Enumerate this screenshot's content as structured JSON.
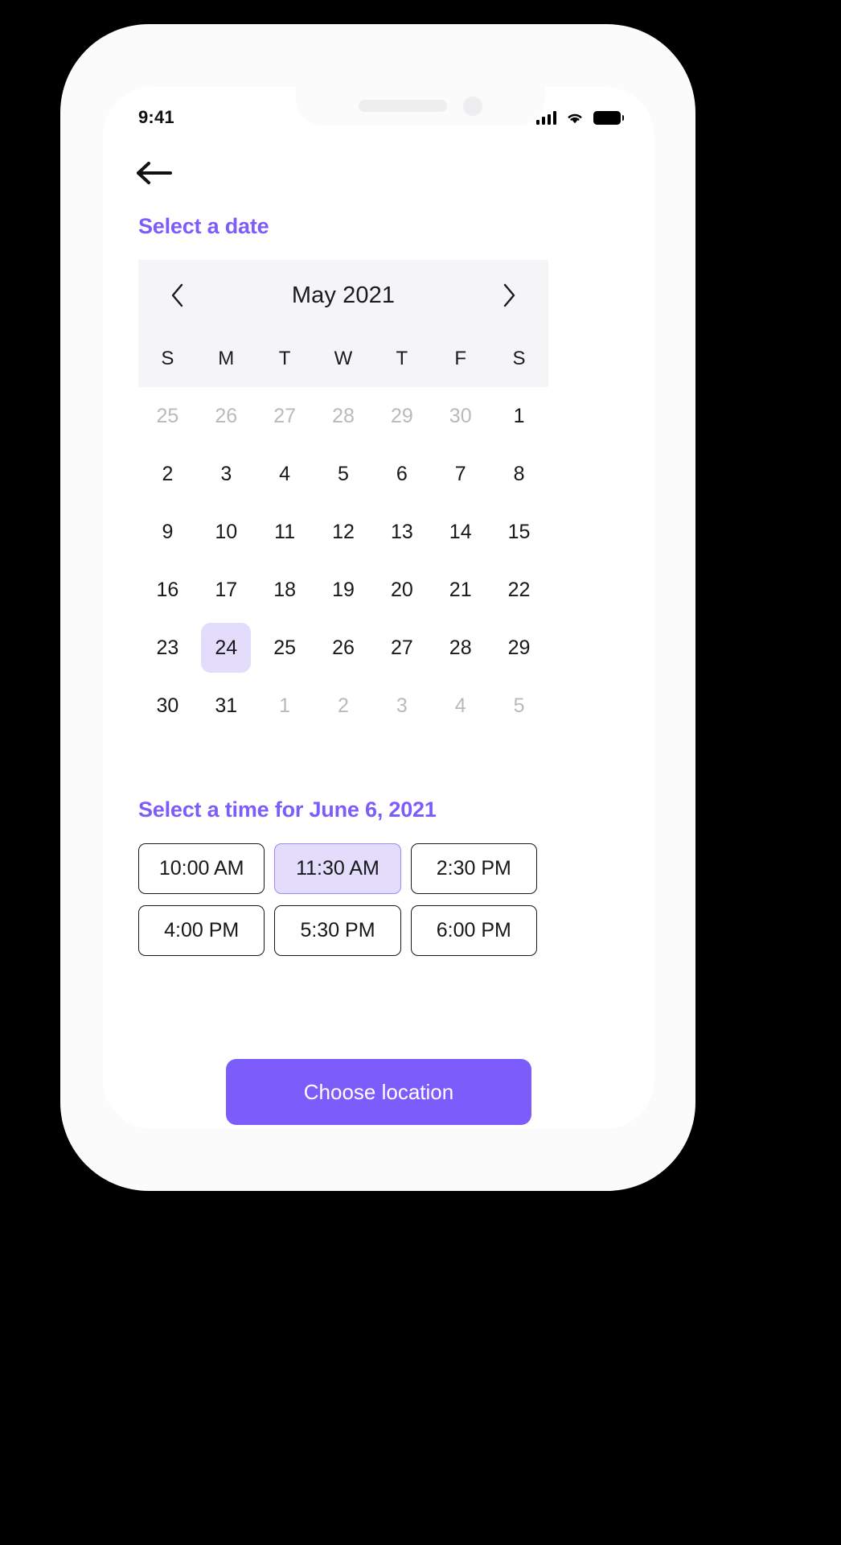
{
  "colors": {
    "accent": "#7c5cfa",
    "selected_bg": "#e3ddfb",
    "selected_border": "#9d87f7",
    "header_bg": "#f5f5f7",
    "text": "#17171c",
    "muted_text": "#b9b9be",
    "page_bg": "#000000",
    "screen_bg": "#ffffff"
  },
  "status_bar": {
    "time": "9:41",
    "icons": [
      "signal-icon",
      "wifi-icon",
      "battery-icon"
    ]
  },
  "nav": {
    "back_icon": "arrow-left-icon"
  },
  "date_section": {
    "title": "Select a date"
  },
  "calendar": {
    "prev_icon": "chevron-left-icon",
    "next_icon": "chevron-right-icon",
    "month_label": "May 2021",
    "weekdays": [
      "S",
      "M",
      "T",
      "W",
      "T",
      "F",
      "S"
    ],
    "weeks": [
      [
        {
          "day": "25",
          "muted": true,
          "selected": false
        },
        {
          "day": "26",
          "muted": true,
          "selected": false
        },
        {
          "day": "27",
          "muted": true,
          "selected": false
        },
        {
          "day": "28",
          "muted": true,
          "selected": false
        },
        {
          "day": "29",
          "muted": true,
          "selected": false
        },
        {
          "day": "30",
          "muted": true,
          "selected": false
        },
        {
          "day": "1",
          "muted": false,
          "selected": false
        }
      ],
      [
        {
          "day": "2",
          "muted": false,
          "selected": false
        },
        {
          "day": "3",
          "muted": false,
          "selected": false
        },
        {
          "day": "4",
          "muted": false,
          "selected": false
        },
        {
          "day": "5",
          "muted": false,
          "selected": false
        },
        {
          "day": "6",
          "muted": false,
          "selected": false
        },
        {
          "day": "7",
          "muted": false,
          "selected": false
        },
        {
          "day": "8",
          "muted": false,
          "selected": false
        }
      ],
      [
        {
          "day": "9",
          "muted": false,
          "selected": false
        },
        {
          "day": "10",
          "muted": false,
          "selected": false
        },
        {
          "day": "11",
          "muted": false,
          "selected": false
        },
        {
          "day": "12",
          "muted": false,
          "selected": false
        },
        {
          "day": "13",
          "muted": false,
          "selected": false
        },
        {
          "day": "14",
          "muted": false,
          "selected": false
        },
        {
          "day": "15",
          "muted": false,
          "selected": false
        }
      ],
      [
        {
          "day": "16",
          "muted": false,
          "selected": false
        },
        {
          "day": "17",
          "muted": false,
          "selected": false
        },
        {
          "day": "18",
          "muted": false,
          "selected": false
        },
        {
          "day": "19",
          "muted": false,
          "selected": false
        },
        {
          "day": "20",
          "muted": false,
          "selected": false
        },
        {
          "day": "21",
          "muted": false,
          "selected": false
        },
        {
          "day": "22",
          "muted": false,
          "selected": false
        }
      ],
      [
        {
          "day": "23",
          "muted": false,
          "selected": false
        },
        {
          "day": "24",
          "muted": false,
          "selected": true
        },
        {
          "day": "25",
          "muted": false,
          "selected": false
        },
        {
          "day": "26",
          "muted": false,
          "selected": false
        },
        {
          "day": "27",
          "muted": false,
          "selected": false
        },
        {
          "day": "28",
          "muted": false,
          "selected": false
        },
        {
          "day": "29",
          "muted": false,
          "selected": false
        }
      ],
      [
        {
          "day": "30",
          "muted": false,
          "selected": false
        },
        {
          "day": "31",
          "muted": false,
          "selected": false
        },
        {
          "day": "1",
          "muted": true,
          "selected": false
        },
        {
          "day": "2",
          "muted": true,
          "selected": false
        },
        {
          "day": "3",
          "muted": true,
          "selected": false
        },
        {
          "day": "4",
          "muted": true,
          "selected": false
        },
        {
          "day": "5",
          "muted": true,
          "selected": false
        }
      ]
    ]
  },
  "time_section": {
    "title": "Select a time for June 6, 2021",
    "slots": [
      {
        "label": "10:00 AM",
        "selected": false
      },
      {
        "label": "11:30 AM",
        "selected": true
      },
      {
        "label": "2:30 PM",
        "selected": false
      },
      {
        "label": "4:00 PM",
        "selected": false
      },
      {
        "label": "5:30 PM",
        "selected": false
      },
      {
        "label": "6:00 PM",
        "selected": false
      }
    ]
  },
  "cta": {
    "label": "Choose location"
  }
}
